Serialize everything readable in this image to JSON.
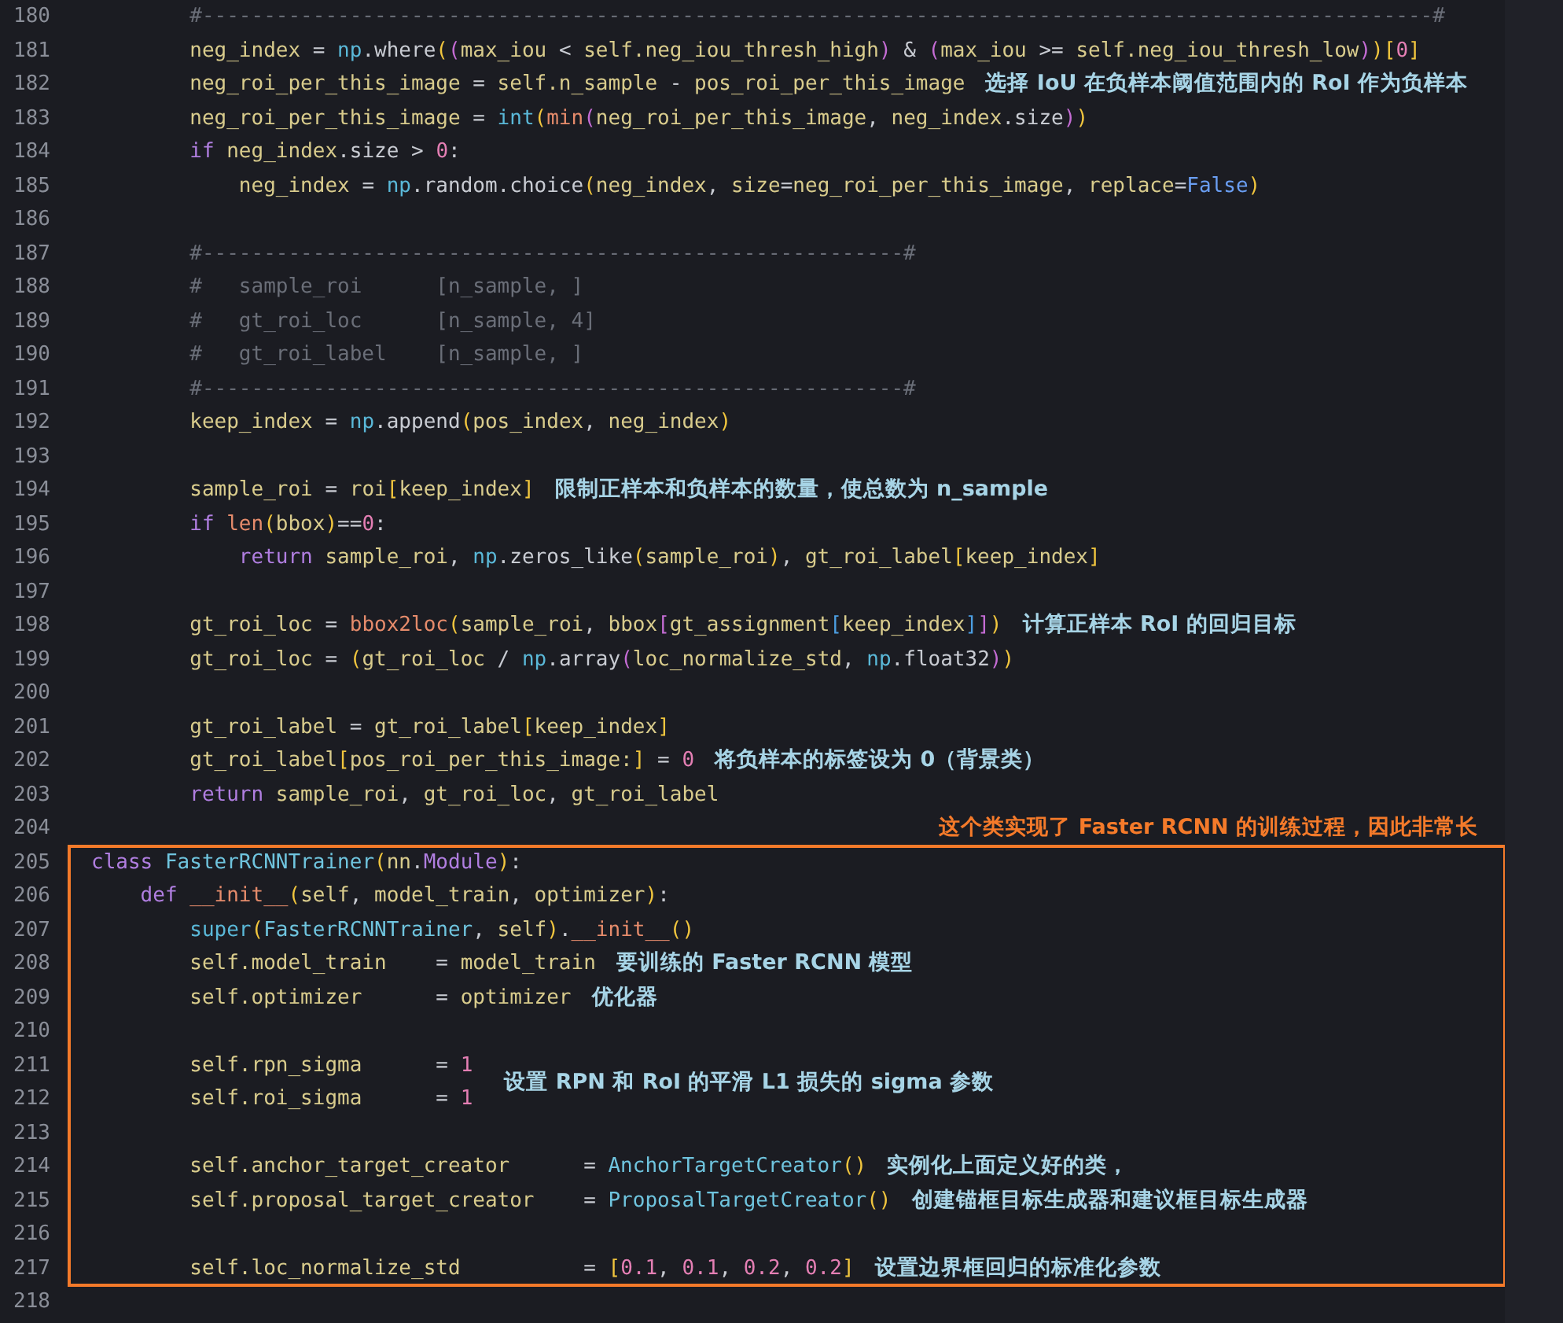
{
  "editor": {
    "sections": [
      {
        "boxed": false,
        "lines": [
          {
            "number": "180",
            "code": [
              {
                "kind": "cm",
                "text": "        #----------------------------------------------------------------------------------------------------#"
              }
            ]
          },
          {
            "number": "181",
            "code": [
              {
                "kind": "var",
                "text": "        neg_index"
              },
              {
                "kind": "op",
                "text": " = "
              },
              {
                "kind": "fn",
                "text": "np"
              },
              {
                "kind": "op",
                "text": ".where"
              },
              {
                "kind": "b1",
                "text": "("
              },
              {
                "kind": "b2",
                "text": "("
              },
              {
                "kind": "var",
                "text": "max_iou"
              },
              {
                "kind": "op",
                "text": " < "
              },
              {
                "kind": "var",
                "text": "self.neg_iou_thresh_high"
              },
              {
                "kind": "b2",
                "text": ")"
              },
              {
                "kind": "op",
                "text": " & "
              },
              {
                "kind": "b2",
                "text": "("
              },
              {
                "kind": "var",
                "text": "max_iou"
              },
              {
                "kind": "op",
                "text": " >= "
              },
              {
                "kind": "var",
                "text": "self.neg_iou_thresh_low"
              },
              {
                "kind": "b2",
                "text": ")"
              },
              {
                "kind": "b1",
                "text": ")["
              },
              {
                "kind": "num",
                "text": "0"
              },
              {
                "kind": "b1",
                "text": "]"
              }
            ]
          },
          {
            "number": "182",
            "code": [
              {
                "kind": "var",
                "text": "        neg_roi_per_this_image"
              },
              {
                "kind": "op",
                "text": " = "
              },
              {
                "kind": "var",
                "text": "self.n_sample"
              },
              {
                "kind": "op",
                "text": " - "
              },
              {
                "kind": "var",
                "text": "pos_roi_per_this_image"
              }
            ],
            "note": {
              "kind": "inline",
              "text": "选择 IoU 在负样本阈值范围内的 RoI 作为负样本"
            }
          },
          {
            "number": "183",
            "code": [
              {
                "kind": "var",
                "text": "        neg_roi_per_this_image"
              },
              {
                "kind": "op",
                "text": " = "
              },
              {
                "kind": "fn",
                "text": "int"
              },
              {
                "kind": "b1",
                "text": "("
              },
              {
                "kind": "call",
                "text": "min"
              },
              {
                "kind": "b2",
                "text": "("
              },
              {
                "kind": "var",
                "text": "neg_roi_per_this_image"
              },
              {
                "kind": "op",
                "text": ", "
              },
              {
                "kind": "var",
                "text": "neg_index"
              },
              {
                "kind": "op",
                "text": ".size"
              },
              {
                "kind": "b2",
                "text": ")"
              },
              {
                "kind": "b1",
                "text": ")"
              }
            ]
          },
          {
            "number": "184",
            "code": [
              {
                "kind": "kw",
                "text": "        if"
              },
              {
                "kind": "var",
                "text": " neg_index"
              },
              {
                "kind": "op",
                "text": ".size > "
              },
              {
                "kind": "num",
                "text": "0"
              },
              {
                "kind": "op",
                "text": ":"
              }
            ]
          },
          {
            "number": "185",
            "code": [
              {
                "kind": "var",
                "text": "            neg_index"
              },
              {
                "kind": "op",
                "text": " = "
              },
              {
                "kind": "fn",
                "text": "np"
              },
              {
                "kind": "op",
                "text": ".random.choice"
              },
              {
                "kind": "b1",
                "text": "("
              },
              {
                "kind": "var",
                "text": "neg_index"
              },
              {
                "kind": "op",
                "text": ", "
              },
              {
                "kind": "var",
                "text": "size"
              },
              {
                "kind": "op",
                "text": "="
              },
              {
                "kind": "var",
                "text": "neg_roi_per_this_image"
              },
              {
                "kind": "op",
                "text": ", "
              },
              {
                "kind": "var",
                "text": "replace"
              },
              {
                "kind": "op",
                "text": "="
              },
              {
                "kind": "const",
                "text": "False"
              },
              {
                "kind": "b1",
                "text": ")"
              }
            ]
          },
          {
            "number": "186"
          },
          {
            "number": "187",
            "code": [
              {
                "kind": "cm",
                "text": "        #---------------------------------------------------------#"
              }
            ]
          },
          {
            "number": "188",
            "code": [
              {
                "kind": "cm",
                "text": "        #   sample_roi      [n_sample, ]"
              }
            ]
          },
          {
            "number": "189",
            "code": [
              {
                "kind": "cm",
                "text": "        #   gt_roi_loc      [n_sample, 4]"
              }
            ]
          },
          {
            "number": "190",
            "code": [
              {
                "kind": "cm",
                "text": "        #   gt_roi_label    [n_sample, ]"
              }
            ]
          },
          {
            "number": "191",
            "code": [
              {
                "kind": "cm",
                "text": "        #---------------------------------------------------------#"
              }
            ]
          },
          {
            "number": "192",
            "code": [
              {
                "kind": "var",
                "text": "        keep_index"
              },
              {
                "kind": "op",
                "text": " = "
              },
              {
                "kind": "fn",
                "text": "np"
              },
              {
                "kind": "op",
                "text": ".append"
              },
              {
                "kind": "b1",
                "text": "("
              },
              {
                "kind": "var",
                "text": "pos_index"
              },
              {
                "kind": "op",
                "text": ", "
              },
              {
                "kind": "var",
                "text": "neg_index"
              },
              {
                "kind": "b1",
                "text": ")"
              }
            ]
          },
          {
            "number": "193"
          },
          {
            "number": "194",
            "code": [
              {
                "kind": "var",
                "text": "        sample_roi"
              },
              {
                "kind": "op",
                "text": " = "
              },
              {
                "kind": "var",
                "text": "roi"
              },
              {
                "kind": "b1",
                "text": "["
              },
              {
                "kind": "var",
                "text": "keep_index"
              },
              {
                "kind": "b1",
                "text": "]"
              }
            ],
            "note": {
              "kind": "inline",
              "text": "限制正样本和负样本的数量，使总数为 n_sample"
            }
          },
          {
            "number": "195",
            "code": [
              {
                "kind": "kw",
                "text": "        if "
              },
              {
                "kind": "call",
                "text": "len"
              },
              {
                "kind": "b1",
                "text": "("
              },
              {
                "kind": "var",
                "text": "bbox"
              },
              {
                "kind": "b1",
                "text": ")"
              },
              {
                "kind": "op",
                "text": "=="
              },
              {
                "kind": "num",
                "text": "0"
              },
              {
                "kind": "op",
                "text": ":"
              }
            ]
          },
          {
            "number": "196",
            "code": [
              {
                "kind": "kw",
                "text": "            return"
              },
              {
                "kind": "var",
                "text": " sample_roi"
              },
              {
                "kind": "op",
                "text": ", "
              },
              {
                "kind": "fn",
                "text": "np"
              },
              {
                "kind": "op",
                "text": ".zeros_like"
              },
              {
                "kind": "b1",
                "text": "("
              },
              {
                "kind": "var",
                "text": "sample_roi"
              },
              {
                "kind": "b1",
                "text": ")"
              },
              {
                "kind": "op",
                "text": ", "
              },
              {
                "kind": "var",
                "text": "gt_roi_label"
              },
              {
                "kind": "b1",
                "text": "["
              },
              {
                "kind": "var",
                "text": "keep_index"
              },
              {
                "kind": "b1",
                "text": "]"
              }
            ]
          },
          {
            "number": "197"
          },
          {
            "number": "198",
            "code": [
              {
                "kind": "var",
                "text": "        gt_roi_loc"
              },
              {
                "kind": "op",
                "text": " = "
              },
              {
                "kind": "call",
                "text": "bbox2loc"
              },
              {
                "kind": "b1",
                "text": "("
              },
              {
                "kind": "var",
                "text": "sample_roi"
              },
              {
                "kind": "op",
                "text": ", "
              },
              {
                "kind": "var",
                "text": "bbox"
              },
              {
                "kind": "b2",
                "text": "["
              },
              {
                "kind": "var",
                "text": "gt_assignment"
              },
              {
                "kind": "b3",
                "text": "["
              },
              {
                "kind": "var",
                "text": "keep_index"
              },
              {
                "kind": "b3",
                "text": "]"
              },
              {
                "kind": "b2",
                "text": "]"
              },
              {
                "kind": "b1",
                "text": ")"
              }
            ],
            "note": {
              "kind": "inline",
              "text": "计算正样本 RoI 的回归目标"
            }
          },
          {
            "number": "199",
            "code": [
              {
                "kind": "var",
                "text": "        gt_roi_loc"
              },
              {
                "kind": "op",
                "text": " = "
              },
              {
                "kind": "b1",
                "text": "("
              },
              {
                "kind": "var",
                "text": "gt_roi_loc"
              },
              {
                "kind": "op",
                "text": " / "
              },
              {
                "kind": "fn",
                "text": "np"
              },
              {
                "kind": "op",
                "text": ".array"
              },
              {
                "kind": "b2",
                "text": "("
              },
              {
                "kind": "var",
                "text": "loc_normalize_std"
              },
              {
                "kind": "op",
                "text": ", "
              },
              {
                "kind": "fn",
                "text": "np"
              },
              {
                "kind": "op",
                "text": ".float32"
              },
              {
                "kind": "b2",
                "text": ")"
              },
              {
                "kind": "b1",
                "text": ")"
              }
            ]
          },
          {
            "number": "200"
          },
          {
            "number": "201",
            "code": [
              {
                "kind": "var",
                "text": "        gt_roi_label"
              },
              {
                "kind": "op",
                "text": " = "
              },
              {
                "kind": "var",
                "text": "gt_roi_label"
              },
              {
                "kind": "b1",
                "text": "["
              },
              {
                "kind": "var",
                "text": "keep_index"
              },
              {
                "kind": "b1",
                "text": "]"
              }
            ]
          },
          {
            "number": "202",
            "code": [
              {
                "kind": "var",
                "text": "        gt_roi_label"
              },
              {
                "kind": "b1",
                "text": "["
              },
              {
                "kind": "var",
                "text": "pos_roi_per_this_image:"
              },
              {
                "kind": "b1",
                "text": "]"
              },
              {
                "kind": "op",
                "text": " = "
              },
              {
                "kind": "num",
                "text": "0"
              }
            ],
            "note": {
              "kind": "inline",
              "text": "将负样本的标签设为 0（背景类）"
            }
          },
          {
            "number": "203",
            "code": [
              {
                "kind": "kw",
                "text": "        return"
              },
              {
                "kind": "var",
                "text": " sample_roi"
              },
              {
                "kind": "op",
                "text": ", "
              },
              {
                "kind": "var",
                "text": "gt_roi_loc"
              },
              {
                "kind": "op",
                "text": ", "
              },
              {
                "kind": "var",
                "text": "gt_roi_label"
              }
            ]
          },
          {
            "number": "204",
            "note": {
              "kind": "banner",
              "text": "这个类实现了 Faster RCNN 的训练过程，因此非常长"
            }
          }
        ]
      },
      {
        "boxed": true,
        "lines": [
          {
            "number": "205",
            "code": [
              {
                "kind": "kw",
                "text": "class "
              },
              {
                "kind": "cls",
                "text": "FasterRCNNTrainer"
              },
              {
                "kind": "b1",
                "text": "("
              },
              {
                "kind": "var",
                "text": "nn"
              },
              {
                "kind": "op",
                "text": "."
              },
              {
                "kind": "kw",
                "text": "Module"
              },
              {
                "kind": "b1",
                "text": ")"
              },
              {
                "kind": "op",
                "text": ":"
              }
            ]
          },
          {
            "number": "206",
            "code": [
              {
                "kind": "kw",
                "text": "    def "
              },
              {
                "kind": "call",
                "text": "__init__"
              },
              {
                "kind": "b1",
                "text": "("
              },
              {
                "kind": "var",
                "text": "self"
              },
              {
                "kind": "op",
                "text": ", "
              },
              {
                "kind": "var",
                "text": "model_train"
              },
              {
                "kind": "op",
                "text": ", "
              },
              {
                "kind": "var",
                "text": "optimizer"
              },
              {
                "kind": "b1",
                "text": ")"
              },
              {
                "kind": "op",
                "text": ":"
              }
            ]
          },
          {
            "number": "207",
            "code": [
              {
                "kind": "fn",
                "text": "        super"
              },
              {
                "kind": "b1",
                "text": "("
              },
              {
                "kind": "cls",
                "text": "FasterRCNNTrainer"
              },
              {
                "kind": "op",
                "text": ", "
              },
              {
                "kind": "var",
                "text": "self"
              },
              {
                "kind": "b1",
                "text": ")"
              },
              {
                "kind": "op",
                "text": "."
              },
              {
                "kind": "call",
                "text": "__init__"
              },
              {
                "kind": "b1",
                "text": "()"
              }
            ]
          },
          {
            "number": "208",
            "code": [
              {
                "kind": "var",
                "text": "        self.model_train    "
              },
              {
                "kind": "op",
                "text": "= "
              },
              {
                "kind": "var",
                "text": "model_train"
              }
            ],
            "note": {
              "kind": "inline",
              "text": "要训练的 Faster RCNN 模型"
            }
          },
          {
            "number": "209",
            "code": [
              {
                "kind": "var",
                "text": "        self.optimizer      "
              },
              {
                "kind": "op",
                "text": "= "
              },
              {
                "kind": "var",
                "text": "optimizer"
              }
            ],
            "note": {
              "kind": "inline",
              "text": "优化器"
            }
          },
          {
            "number": "210"
          },
          {
            "number": "211",
            "code": [
              {
                "kind": "var",
                "text": "        self.rpn_sigma      "
              },
              {
                "kind": "op",
                "text": "= "
              },
              {
                "kind": "num",
                "text": "1"
              }
            ],
            "note": {
              "kind": "spanning",
              "text": "设置 RPN 和 RoI 的平滑 L1 损失的 sigma 参数"
            }
          },
          {
            "number": "212",
            "code": [
              {
                "kind": "var",
                "text": "        self.roi_sigma      "
              },
              {
                "kind": "op",
                "text": "= "
              },
              {
                "kind": "num",
                "text": "1"
              }
            ]
          },
          {
            "number": "213"
          },
          {
            "number": "214",
            "code": [
              {
                "kind": "var",
                "text": "        self.anchor_target_creator      "
              },
              {
                "kind": "op",
                "text": "= "
              },
              {
                "kind": "cls",
                "text": "AnchorTargetCreator"
              },
              {
                "kind": "b1",
                "text": "()"
              }
            ],
            "note": {
              "kind": "inline",
              "text": "实例化上面定义好的类，"
            }
          },
          {
            "number": "215",
            "code": [
              {
                "kind": "var",
                "text": "        self.proposal_target_creator    "
              },
              {
                "kind": "op",
                "text": "= "
              },
              {
                "kind": "cls",
                "text": "ProposalTargetCreator"
              },
              {
                "kind": "b1",
                "text": "()"
              }
            ],
            "note": {
              "kind": "inline",
              "text": "创建锚框目标生成器和建议框目标生成器"
            }
          },
          {
            "number": "216"
          },
          {
            "number": "217",
            "code": [
              {
                "kind": "var",
                "text": "        self.loc_normalize_std          "
              },
              {
                "kind": "op",
                "text": "= "
              },
              {
                "kind": "b1",
                "text": "["
              },
              {
                "kind": "num",
                "text": "0.1"
              },
              {
                "kind": "op",
                "text": ", "
              },
              {
                "kind": "num",
                "text": "0.1"
              },
              {
                "kind": "op",
                "text": ", "
              },
              {
                "kind": "num",
                "text": "0.2"
              },
              {
                "kind": "op",
                "text": ", "
              },
              {
                "kind": "num",
                "text": "0.2"
              },
              {
                "kind": "b1",
                "text": "]"
              }
            ],
            "note": {
              "kind": "inline",
              "text": "设置边界框回归的标准化参数"
            }
          }
        ]
      },
      {
        "boxed": false,
        "lines": [
          {
            "number": "218"
          }
        ]
      }
    ]
  }
}
